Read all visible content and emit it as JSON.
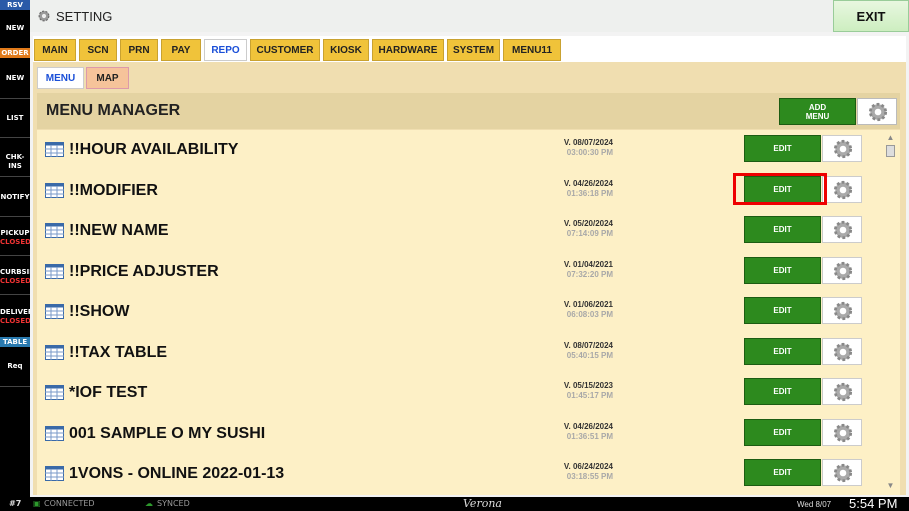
{
  "sidebar": {
    "rsv": "RSV",
    "items": [
      {
        "label": "NEW"
      },
      {
        "label": "ORDER"
      },
      {
        "label": "NEW"
      },
      {
        "label": "LIST"
      },
      {
        "label": "CHK-INS"
      },
      {
        "label": "NOTIFY"
      },
      {
        "label": "PICKUP",
        "status": "CLOSED"
      },
      {
        "label": "CURBSID",
        "status": "CLOSED"
      },
      {
        "label": "DELIVER",
        "status": "CLOSED"
      },
      {
        "label": "TABLE"
      },
      {
        "label": "Req"
      }
    ]
  },
  "topbar": {
    "title": "SETTING",
    "exit": "EXIT"
  },
  "tabs": [
    "MAIN",
    "SCN",
    "PRN",
    "PAY",
    "REPO",
    "CUSTOMER",
    "KIOSK",
    "HARDWARE",
    "SYSTEM",
    "MENU11"
  ],
  "active_tab": "REPO",
  "subtabs": [
    "MENU",
    "MAP"
  ],
  "manager": {
    "title": "MENU MANAGER",
    "add_label_1": "ADD",
    "add_label_2": "MENU"
  },
  "rows": [
    {
      "name": "!!HOUR AVAILABILITY",
      "version": "V. 08/07/2024",
      "time": "03:00:30 PM",
      "edit": "EDIT"
    },
    {
      "name": "!!MODIFIER",
      "version": "V. 04/26/2024",
      "time": "01:36:18 PM",
      "edit": "EDIT"
    },
    {
      "name": "!!NEW NAME",
      "version": "V. 05/20/2024",
      "time": "07:14:09 PM",
      "edit": "EDIT"
    },
    {
      "name": "!!PRICE ADJUSTER",
      "version": "V. 01/04/2021",
      "time": "07:32:20 PM",
      "edit": "EDIT"
    },
    {
      "name": "!!SHOW",
      "version": "V. 01/06/2021",
      "time": "06:08:03 PM",
      "edit": "EDIT"
    },
    {
      "name": "!!TAX TABLE",
      "version": "V. 08/07/2024",
      "time": "05:40:15 PM",
      "edit": "EDIT"
    },
    {
      "name": "*IOF TEST",
      "version": "V. 05/15/2023",
      "time": "01:45:17 PM",
      "edit": "EDIT"
    },
    {
      "name": "001 SAMPLE O MY SUSHI",
      "version": "V. 04/26/2024",
      "time": "01:36:51 PM",
      "edit": "EDIT"
    },
    {
      "name": "1VONS - ONLINE 2022-01-13",
      "version": "V. 06/24/2024",
      "time": "03:18:55 PM",
      "edit": "EDIT"
    }
  ],
  "statusbar": {
    "station": "#7",
    "connected": "CONNECTED",
    "synced": "SYNCED",
    "location": "Verona",
    "date": "Wed 8/07",
    "time": "5:54 PM"
  },
  "colors": {
    "tab_yellow": "#f0c33a",
    "edit_green": "#2d8a1e",
    "highlight": "#e00000",
    "closed_red": "#e33333"
  }
}
